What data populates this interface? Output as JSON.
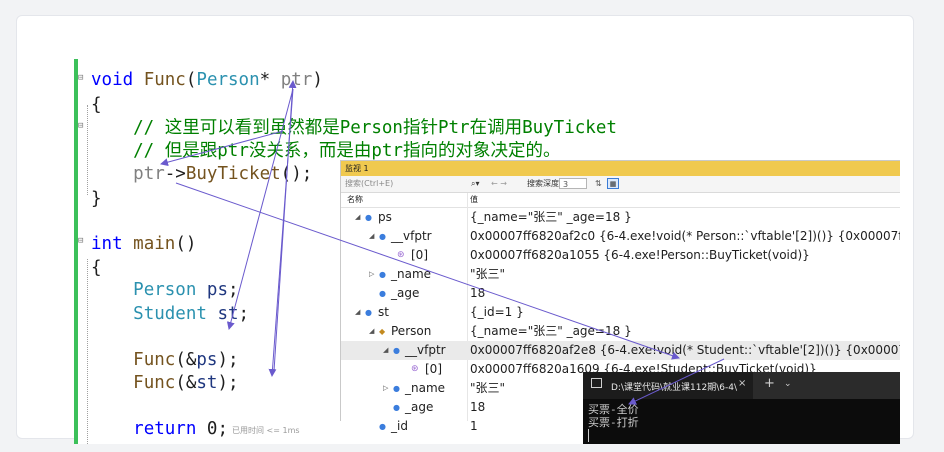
{
  "code": {
    "lines": [
      {
        "id": "l1",
        "parts": [
          {
            "t": "void",
            "c": "kw"
          },
          {
            "t": " ",
            "c": "df"
          },
          {
            "t": "Func",
            "c": "fn"
          },
          {
            "t": "(",
            "c": "df"
          },
          {
            "t": "Person",
            "c": "ty"
          },
          {
            "t": "* ",
            "c": "df"
          },
          {
            "t": "ptr",
            "c": "pm"
          },
          {
            "t": ")",
            "c": "df"
          }
        ]
      },
      {
        "id": "l2",
        "parts": [
          {
            "t": "{",
            "c": "df"
          }
        ]
      },
      {
        "id": "l3",
        "parts": [
          {
            "t": "    // 这里可以看到虽然都是Person指针Ptr在调用BuyTicket",
            "c": "cm"
          }
        ]
      },
      {
        "id": "l4",
        "parts": [
          {
            "t": "    // 但是跟ptr没关系，而是由ptr指向的对象决定的。",
            "c": "cm"
          }
        ]
      },
      {
        "id": "l5",
        "parts": [
          {
            "t": "    ",
            "c": "df"
          },
          {
            "t": "ptr",
            "c": "pm"
          },
          {
            "t": "->",
            "c": "df"
          },
          {
            "t": "BuyTicket",
            "c": "fn"
          },
          {
            "t": "();",
            "c": "df"
          }
        ]
      },
      {
        "id": "l6",
        "parts": [
          {
            "t": "}",
            "c": "df"
          }
        ]
      },
      {
        "id": "l7",
        "parts": [
          {
            "t": "int",
            "c": "kw"
          },
          {
            "t": " ",
            "c": "df"
          },
          {
            "t": "main",
            "c": "fn"
          },
          {
            "t": "()",
            "c": "df"
          }
        ]
      },
      {
        "id": "l8",
        "parts": [
          {
            "t": "{",
            "c": "df"
          }
        ]
      },
      {
        "id": "l9",
        "parts": [
          {
            "t": "    ",
            "c": "df"
          },
          {
            "t": "Person",
            "c": "ty"
          },
          {
            "t": " ",
            "c": "df"
          },
          {
            "t": "ps",
            "c": "id"
          },
          {
            "t": ";",
            "c": "df"
          }
        ]
      },
      {
        "id": "l10",
        "parts": [
          {
            "t": "    ",
            "c": "df"
          },
          {
            "t": "Student",
            "c": "ty"
          },
          {
            "t": " ",
            "c": "df"
          },
          {
            "t": "st",
            "c": "id"
          },
          {
            "t": ";",
            "c": "df"
          }
        ]
      },
      {
        "id": "l11",
        "parts": [
          {
            "t": "    ",
            "c": "df"
          },
          {
            "t": "Func",
            "c": "fn"
          },
          {
            "t": "(&",
            "c": "df"
          },
          {
            "t": "ps",
            "c": "id"
          },
          {
            "t": ");",
            "c": "df"
          }
        ]
      },
      {
        "id": "l12",
        "parts": [
          {
            "t": "    ",
            "c": "df"
          },
          {
            "t": "Func",
            "c": "fn"
          },
          {
            "t": "(&",
            "c": "df"
          },
          {
            "t": "st",
            "c": "id"
          },
          {
            "t": ");",
            "c": "df"
          }
        ]
      },
      {
        "id": "l13",
        "parts": [
          {
            "t": "    ",
            "c": "df"
          },
          {
            "t": "return",
            "c": "kw"
          },
          {
            "t": " 0;",
            "c": "df"
          }
        ]
      }
    ],
    "elapsed_label": "已用时间 <= 1ms"
  },
  "watch": {
    "title": "监视 1",
    "search_placeholder": "搜索(Ctrl+E)",
    "search_icon": "⌕▾",
    "nav_arrows": "← →",
    "depth_label": "搜索深度:",
    "depth_value": "3",
    "pin_icon": "⇅",
    "grid_icon": "▦",
    "col_name": "名称",
    "col_value": "值",
    "rows": [
      {
        "name": "ps",
        "value": "{_name=\"张三\" _age=18 }"
      },
      {
        "name": "__vfptr",
        "value": "0x00007ff6820af2c0 {6-4.exe!void(* Person::`vftable'[2])()} {0x00007ff6820a1055"
      },
      {
        "name": "[0]",
        "value": "0x00007ff6820a1055 {6-4.exe!Person::BuyTicket(void)}"
      },
      {
        "name": "_name",
        "value": "\"张三\""
      },
      {
        "name": "_age",
        "value": "18"
      },
      {
        "name": "st",
        "value": "{_id=1 }"
      },
      {
        "name": "Person",
        "value": "{_name=\"张三\" _age=18 }"
      },
      {
        "name": "__vfptr",
        "value": "0x00007ff6820af2e8 {6-4.exe!void(* Student::`vftable'[2])()} {0x00007ff6820a160"
      },
      {
        "name": "[0]",
        "value": "0x00007ff6820a1609 {6-4.exe!Student::BuyTicket(void)}"
      },
      {
        "name": "_name",
        "value": "\"张三\""
      },
      {
        "name": "_age",
        "value": "18"
      },
      {
        "name": "_id",
        "value": "1"
      }
    ]
  },
  "terminal": {
    "tab_title": "D:\\课堂代码\\就业课112期\\6-4\\",
    "close_glyph": "×",
    "plus_glyph": "+",
    "dropdown_glyph": "⌄",
    "output_lines": "买票-全价\n买票-打折"
  },
  "colors": {
    "accent_green": "#3cc05a",
    "watch_title_bg": "#f0c94f",
    "annotation_arrow": "#6a5acd"
  }
}
